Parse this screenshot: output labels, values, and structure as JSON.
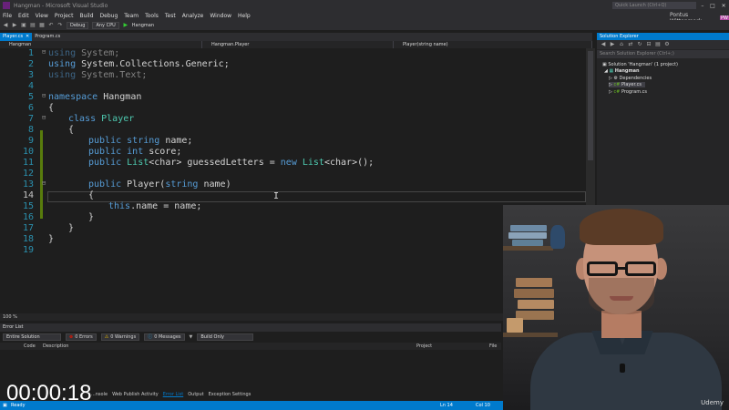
{
  "window": {
    "title": "Hangman - Microsoft Visual Studio",
    "quick_launch": "Quick Launch (Ctrl+Q)"
  },
  "menu": [
    "File",
    "Edit",
    "View",
    "Project",
    "Build",
    "Debug",
    "Team",
    "Tools",
    "Test",
    "Analyze",
    "Window",
    "Help"
  ],
  "user": {
    "name": "Pontus Wittenmark",
    "initials": "PW"
  },
  "toolbar": {
    "config": "Debug",
    "platform": "Any CPU",
    "start": "Hangman"
  },
  "doc_tabs": [
    {
      "label": "Player.cs",
      "active": true
    },
    {
      "label": "Program.cs",
      "active": false
    }
  ],
  "nav_bar": {
    "project": "Hangman",
    "type": "Hangman.Player",
    "member": "Player(string name)"
  },
  "code": {
    "lines": [
      {
        "n": "1",
        "t": "using System;"
      },
      {
        "n": "2",
        "t": "using System.Collections.Generic;"
      },
      {
        "n": "3",
        "t": "using System.Text;"
      },
      {
        "n": "4",
        "t": ""
      },
      {
        "n": "5",
        "t": "namespace Hangman"
      },
      {
        "n": "6",
        "t": "{"
      },
      {
        "n": "7",
        "t": "class Player"
      },
      {
        "n": "8",
        "t": "{"
      },
      {
        "n": "9",
        "t": "public string name;"
      },
      {
        "n": "10",
        "t": "public int score;"
      },
      {
        "n": "11",
        "t": "public List<char> guessedLetters = new List<char>();"
      },
      {
        "n": "12",
        "t": ""
      },
      {
        "n": "13",
        "t": "public Player(string name)"
      },
      {
        "n": "14",
        "t": "{"
      },
      {
        "n": "15",
        "t": "this.name = name;"
      },
      {
        "n": "16",
        "t": "}"
      },
      {
        "n": "17",
        "t": "}"
      },
      {
        "n": "18",
        "t": "}"
      },
      {
        "n": "19",
        "t": ""
      }
    ]
  },
  "zoom": "100 %",
  "solution_explorer": {
    "title": "Solution Explorer",
    "search": "Search Solution Explorer (Ctrl+;)",
    "items": [
      "Solution 'Hangman' (1 project)",
      "Hangman",
      "Dependencies",
      "Player.cs",
      "Program.cs"
    ]
  },
  "error_list": {
    "title": "Error List",
    "scope": "Entire Solution",
    "errors": "0 Errors",
    "warnings": "0 Warnings",
    "messages": "0 Messages",
    "build": "Build Only",
    "columns": [
      "Code",
      "Description",
      "Project",
      "File"
    ]
  },
  "bottom_tabs": [
    "...nsole",
    "Web Publish Activity",
    "Error List",
    "Output",
    "Exception Settings"
  ],
  "status": {
    "ready": "Ready",
    "ln": "Ln 14",
    "col": "Col 10"
  },
  "video": {
    "timer": "00:00:18",
    "watermark": "Udemy"
  },
  "colors": {
    "accent": "#007acc",
    "keyword": "#569cd6",
    "type": "#4ec9b0",
    "line_number": "#2b91af"
  }
}
